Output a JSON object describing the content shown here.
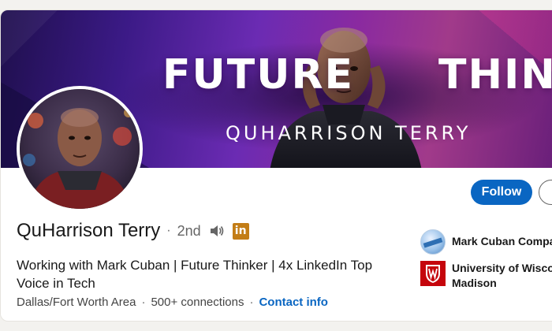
{
  "banner": {
    "title_left": "FUTURE",
    "title_right": "THINKIN",
    "subtitle": "QUHARRISON TERRY",
    "colors": {
      "deep": "#1f0f4d",
      "purple": "#6b2bb3",
      "magenta": "#a13a8a"
    }
  },
  "profile": {
    "name": "QuHarrison Terry",
    "separator": "·",
    "degree": "2nd",
    "speaker_icon": "speaker-icon",
    "badge_text": "in",
    "badge_color": "#c37d16",
    "headline": "Working with Mark Cuban | Future Thinker | 4x LinkedIn Top Voice in Tech",
    "location": "Dallas/Fort Worth Area",
    "connections": "500+ connections",
    "contact_link": "Contact info"
  },
  "actions": {
    "follow_label": "Follow",
    "accent_color": "#0a66c2"
  },
  "experience": [
    {
      "name": "Mark Cuban Compar",
      "logo": "mark-cuban-logo"
    },
    {
      "name": "University of Wiscon\nMadison",
      "line1": "University of Wiscon",
      "line2": "Madison",
      "logo": "uw-crest-logo"
    }
  ]
}
